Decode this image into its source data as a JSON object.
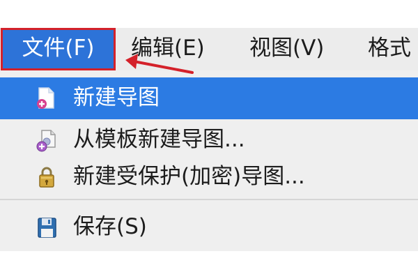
{
  "menubar": {
    "items": [
      {
        "label": "文件(F)"
      },
      {
        "label": "编辑(E)"
      },
      {
        "label": "视图(V)"
      },
      {
        "label": "格式"
      }
    ]
  },
  "file_menu": {
    "items": [
      {
        "label": "新建导图",
        "icon": "new-map-icon",
        "highlighted": true
      },
      {
        "label": "从模板新建导图...",
        "icon": "template-icon",
        "highlighted": false
      },
      {
        "label": "新建受保护(加密)导图...",
        "icon": "lock-icon",
        "highlighted": false
      },
      {
        "label": "保存(S)",
        "icon": "save-disk-icon",
        "highlighted": false
      }
    ]
  },
  "colors": {
    "highlight": "#2c7be3",
    "annotation": "#d4212a"
  }
}
